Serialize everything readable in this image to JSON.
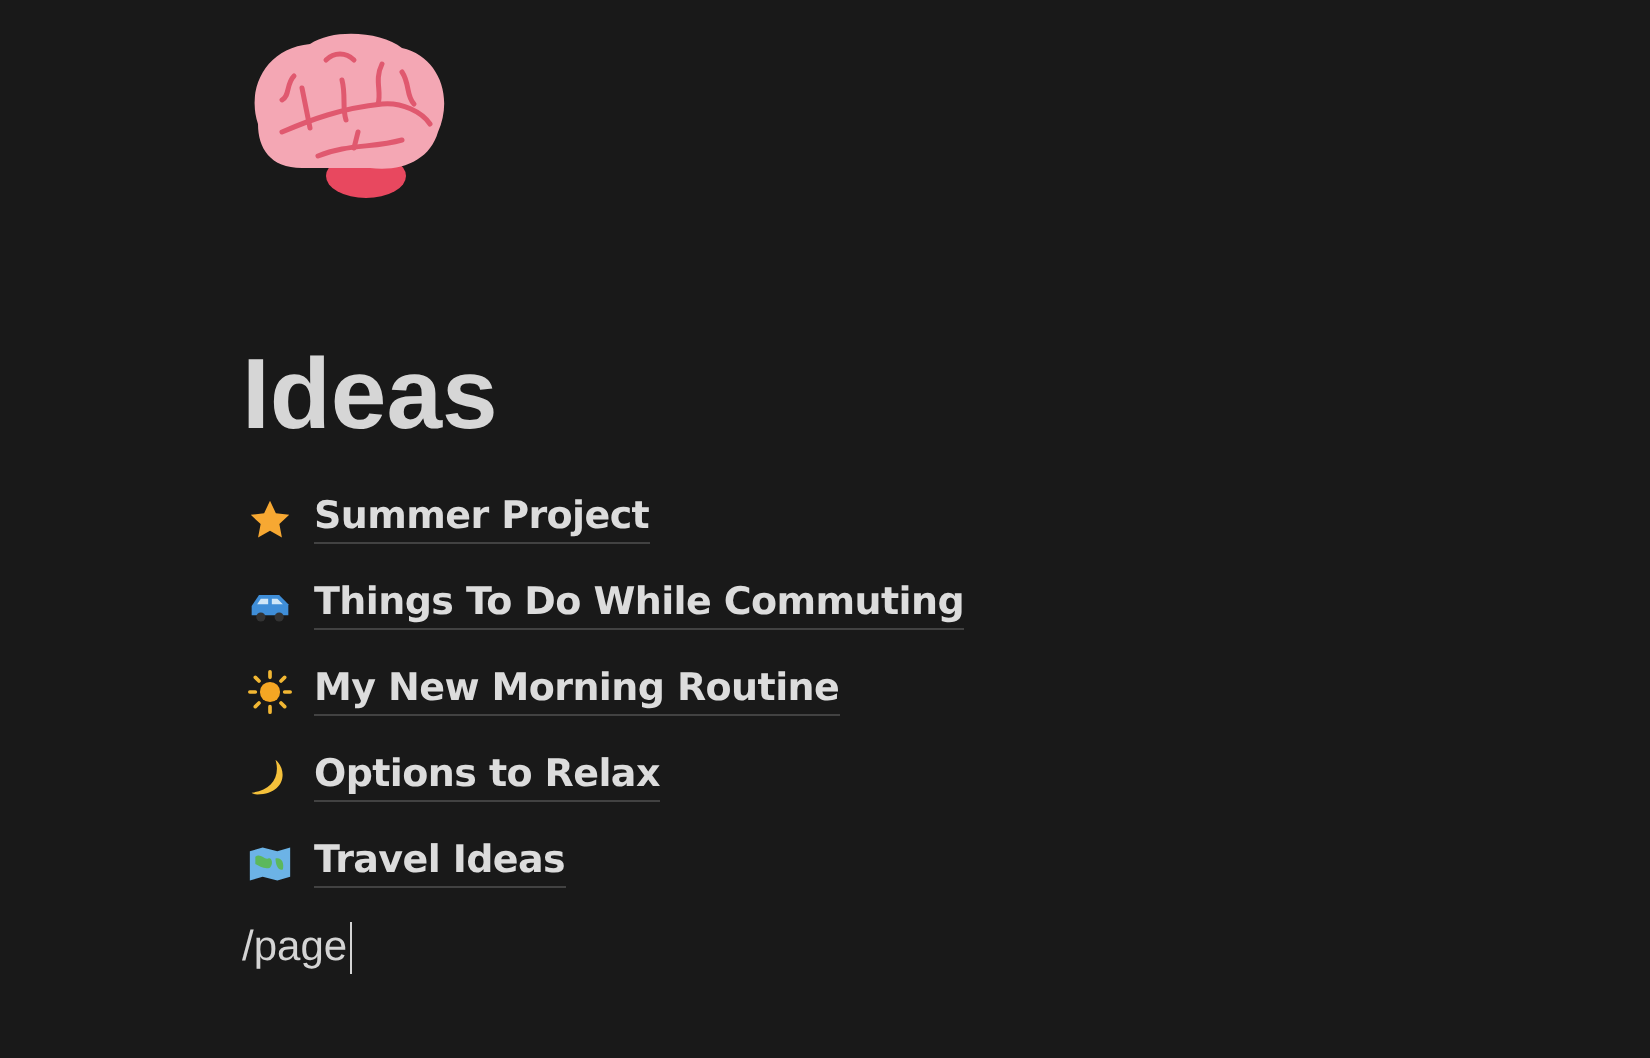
{
  "page": {
    "title": "Ideas",
    "icon": {
      "kind": "brain"
    }
  },
  "links": [
    {
      "kind": "star",
      "label": "Summer Project"
    },
    {
      "kind": "car",
      "label": "Things To Do While Commuting"
    },
    {
      "kind": "sun",
      "label": "My New Morning Routine"
    },
    {
      "kind": "moon",
      "label": "Options to Relax"
    },
    {
      "kind": "map",
      "label": "Travel Ideas"
    }
  ],
  "editor": {
    "value": "/page"
  }
}
